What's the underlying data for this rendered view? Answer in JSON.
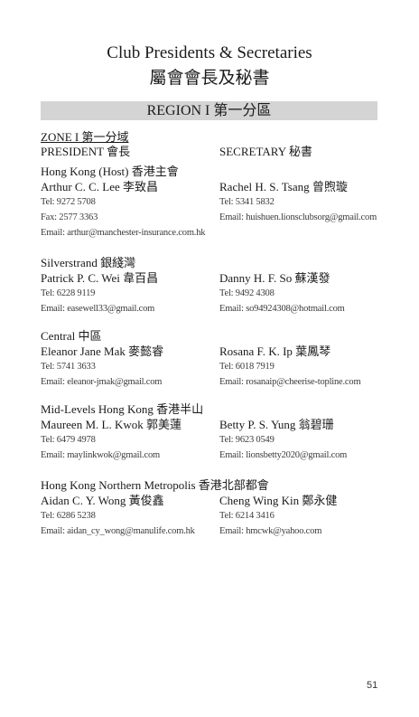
{
  "title_en": "Club Presidents & Secretaries",
  "title_zh": "屬會會長及秘書",
  "region": "REGION I  第一分區",
  "zone": "ZONE I  第一分域",
  "president_header": "PRESIDENT  會長",
  "secretary_header": "SECRETARY  秘書",
  "clubs": [
    {
      "name": "Hong Kong (Host)  香港主會",
      "president": {
        "name": "Arthur C. C. Lee  李致昌",
        "lines": [
          "Tel: 9272 5708",
          "Fax: 2577 3363",
          "Email: arthur@manchester-insurance.com.hk"
        ]
      },
      "secretary": {
        "name": "Rachel H. S. Tsang  曾煦璇",
        "lines": [
          "Tel: 5341 5832",
          "Email: huishuen.lionsclubsorg@gmail.com"
        ]
      }
    },
    {
      "name": "Silverstrand  銀綫灣",
      "president": {
        "name": "Patrick P. C. Wei  韋百昌",
        "lines": [
          "Tel: 6228 9119",
          "Email: easewell33@gmail.com"
        ]
      },
      "secretary": {
        "name": "Danny H. F. So  蘇漢發",
        "lines": [
          "Tel: 9492 4308",
          "Email: so94924308@hotmail.com"
        ]
      }
    },
    {
      "name": "Central  中區",
      "president": {
        "name": "Eleanor Jane Mak  麥懿睿",
        "lines": [
          "Tel: 5741 3633",
          "Email: eleanor-jmak@gmail.com"
        ]
      },
      "secretary": {
        "name": "Rosana F. K. Ip  葉鳳琴",
        "lines": [
          "Tel: 6018 7919",
          "Email: rosanaip@cheerise-topline.com"
        ]
      }
    },
    {
      "name": "Mid-Levels Hong Kong  香港半山",
      "president": {
        "name": "Maureen M. L. Kwok  郭美蓮",
        "lines": [
          "Tel: 6479 4978",
          "Email: maylinkwok@gmail.com"
        ]
      },
      "secretary": {
        "name": "Betty P. S. Yung  翁碧珊",
        "lines": [
          "Tel: 9623 0549",
          "Email: lionsbetty2020@gmail.com"
        ]
      }
    },
    {
      "name": "Hong Kong Northern Metropolis  香港北部都會",
      "president": {
        "name": "Aidan C. Y. Wong  黃俊鑫",
        "lines": [
          "Tel: 6286 5238",
          "Email: aidan_cy_wong@manulife.com.hk"
        ]
      },
      "secretary": {
        "name": "Cheng Wing Kin  鄭永健",
        "lines": [
          "Tel: 6214 3416",
          "Email: hmcwk@yahoo.com"
        ]
      }
    }
  ],
  "page_number": "51"
}
